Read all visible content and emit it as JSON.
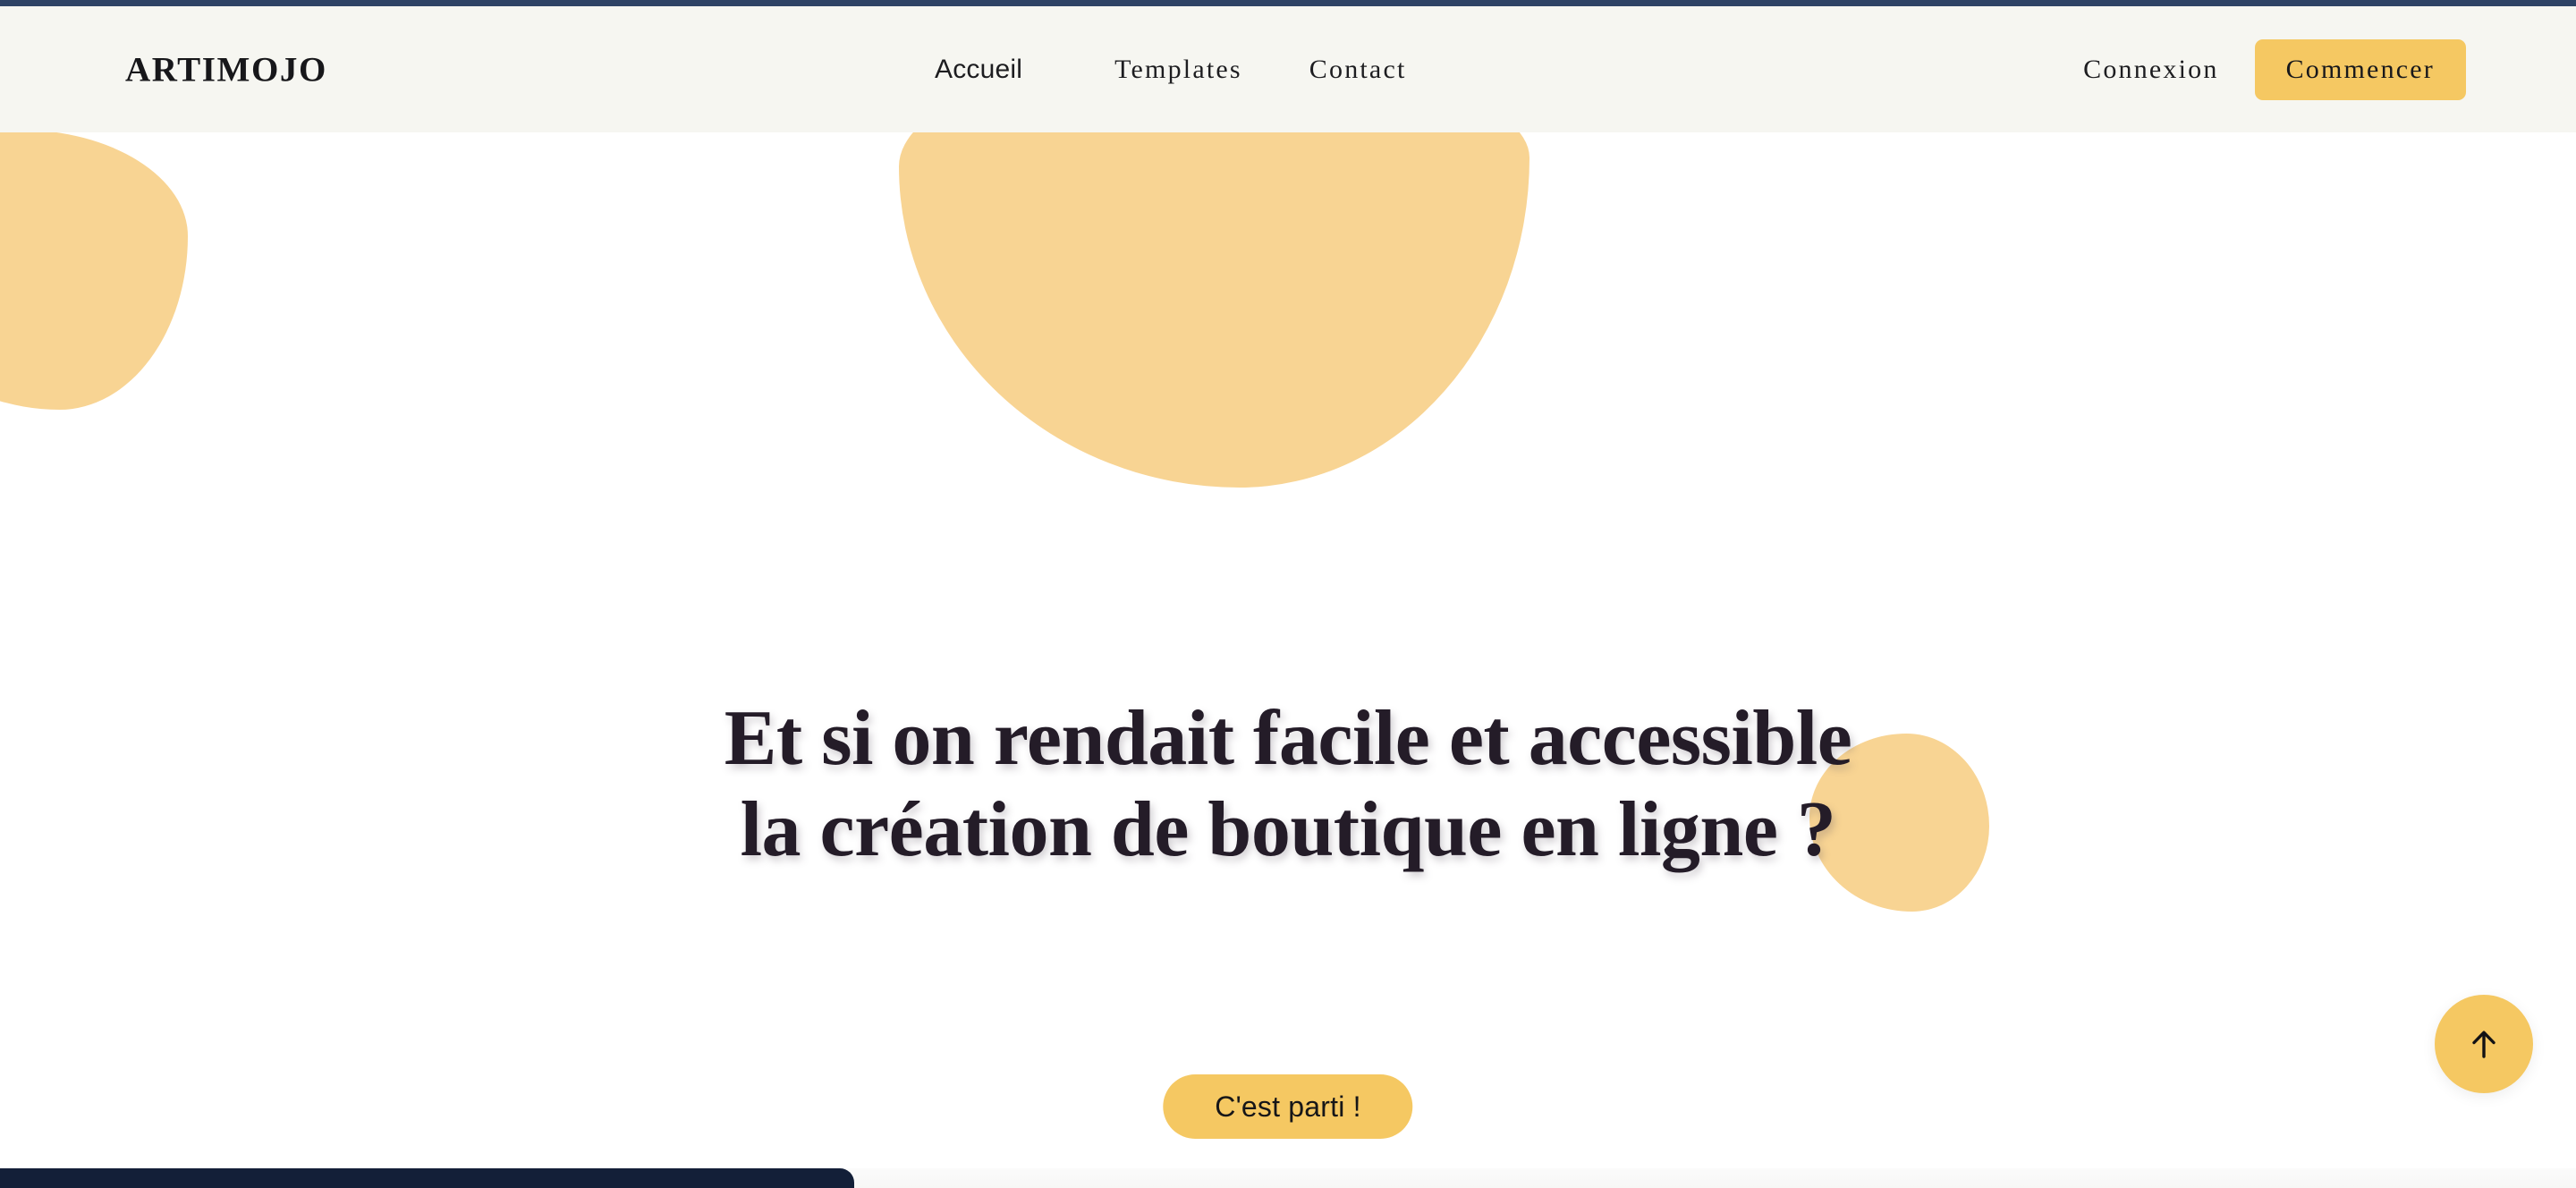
{
  "colors": {
    "top_strip": "#2e4365",
    "header_bg": "#f6f6f1",
    "page_bg": "#ffffff",
    "blob": "#f8d493",
    "accent_button": "#f5c862",
    "heading_text": "#241c28",
    "footer_navy": "#131f38"
  },
  "header": {
    "brand": "ARTIMOJO",
    "nav": [
      {
        "label": "Accueil",
        "style": "sans"
      },
      {
        "label": "Templates",
        "style": "serif"
      },
      {
        "label": "Contact",
        "style": "serif"
      }
    ],
    "login_label": "Connexion",
    "start_label": "Commencer"
  },
  "hero": {
    "title": "Et si on rendait facile et accessible la création de boutique en ligne ?",
    "cta_label": "C'est parti !"
  },
  "scroll_top": {
    "icon": "arrow-up-icon",
    "aria_label": "Retour en haut"
  }
}
